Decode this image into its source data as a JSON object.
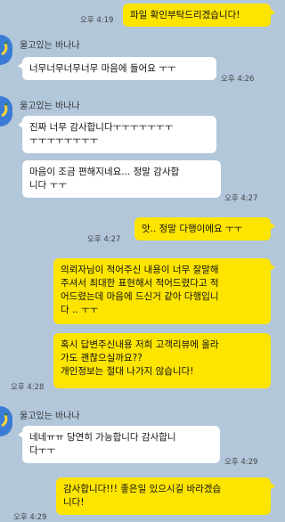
{
  "messages": [
    {
      "side": "me",
      "text": "파일 확인부탁드리겠습니다!",
      "time": "오후 4:19"
    },
    {
      "side": "them",
      "sender": "울고있는 바나나",
      "text": "너무너무너무너무 마음에 들어요 ㅜㅜ",
      "time": "오후 4:26"
    },
    {
      "side": "them",
      "sender": "울고있는 바나나",
      "text": "진짜 너무 감사합니다ㅜㅜㅜㅜㅜㅜㅜ\nㅜㅜㅜㅜㅜㅜㅜㅜ",
      "time": ""
    },
    {
      "side": "them",
      "text": "마음이 조금 편해지네요... 정말 감사합\n니다 ㅜㅜ",
      "time": "오후 4:27"
    },
    {
      "side": "me",
      "text": "앗.. 정말 다행이에요 ㅜㅜ",
      "time": "오후 4:27"
    },
    {
      "side": "me",
      "text": "의뢰자님이 적어주신 내용이 너무 잘말해\n주셔서 최대한 표현해서 적어드렸다고 적\n어드렸는데 마음에 드신거 같아 다행입니\n다 .. ㅜㅜ",
      "time": ""
    },
    {
      "side": "me",
      "text": "혹시 답변주신내용 저희 고객리뷰에 올라\n가도 괜찮으실까요??\n개인정보는 절대 나가지 않습니다!",
      "time": "오후 4:28"
    },
    {
      "side": "them",
      "sender": "울고있는 바나나",
      "text": "네네ㅠㅠ 당연히 가능합니다 감사합니\n다ㅜㅜ",
      "time": "오후 4:29"
    },
    {
      "side": "me",
      "text": "감사합니다!!! 좋은일 있으시길 바라겠습\n니다!",
      "time": "오후 4:29"
    }
  ],
  "colors": {
    "background": "#b2c7da",
    "my_bubble": "#fee500",
    "their_bubble": "#ffffff"
  },
  "icons": {
    "avatar": "banana-avatar-icon"
  }
}
